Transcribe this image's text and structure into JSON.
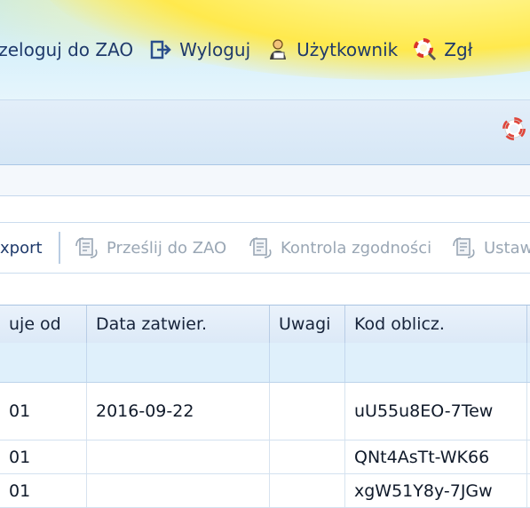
{
  "topnav": {
    "items": [
      {
        "label": "rzeloguj do ZAO",
        "icon": "swap-icon"
      },
      {
        "label": "Wyloguj",
        "icon": "logout-icon"
      },
      {
        "label": "Użytkownik",
        "icon": "user-icon"
      },
      {
        "label": "Zgł",
        "icon": "lifebuoy-search-icon"
      }
    ]
  },
  "bar2": {
    "icon": "lifebuoy-icon"
  },
  "toolbar": {
    "export_label": "xport",
    "send_label": "Prześlij do ZAO",
    "check_label": "Kontrola zgodności",
    "settings_label": "Ustaw"
  },
  "grid": {
    "columns": [
      "uje od",
      "Data zatwier.",
      "Uwagi",
      "Kod oblicz."
    ],
    "rows": [
      [
        "01",
        "2016-09-22",
        "",
        "uU55u8EO-7Tew"
      ],
      [
        "01",
        "",
        "",
        "QNt4AsTt-WK66"
      ],
      [
        "01",
        "",
        "",
        "xgW51Y8y-7JGw"
      ]
    ]
  },
  "colors": {
    "nav_text": "#1f3a6b",
    "disabled_text": "#9aa7b5",
    "header_bg": "#dce9f7"
  }
}
